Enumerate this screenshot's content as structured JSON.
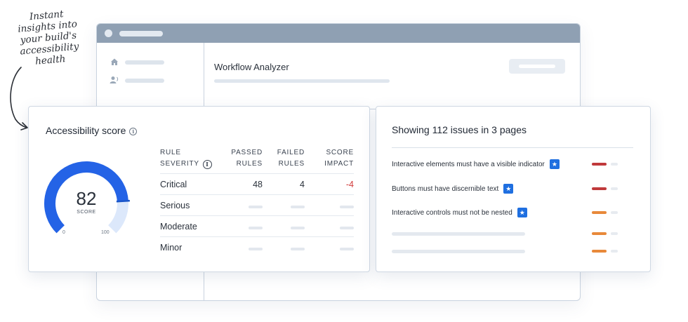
{
  "annotation": {
    "lines": [
      "Instant",
      "insights into",
      "your build's",
      "accessibility",
      "health"
    ]
  },
  "window": {
    "title": "Workflow Analyzer",
    "sidebar_icons": [
      "home-icon",
      "users-icon"
    ]
  },
  "score_card": {
    "title": "Accessibility score",
    "gauge": {
      "score": "82",
      "score_label": "SCORE",
      "min_label": "0",
      "max_label": "100",
      "value_fraction": 0.82,
      "fill_color": "#2463e6",
      "track_color": "#dce8fb"
    },
    "table": {
      "headers": {
        "severity_line1": "RULE",
        "severity_line2": "SEVERITY",
        "passed_line1": "PASSED",
        "passed_line2": "RULES",
        "failed_line1": "FAILED",
        "failed_line2": "RULES",
        "impact_line1": "SCORE",
        "impact_line2": "IMPACT"
      },
      "rows": [
        {
          "severity": "Critical",
          "passed": "48",
          "failed": "4",
          "impact": "-4"
        },
        {
          "severity": "Serious",
          "passed": "",
          "failed": "",
          "impact": ""
        },
        {
          "severity": "Moderate",
          "passed": "",
          "failed": "",
          "impact": ""
        },
        {
          "severity": "Minor",
          "passed": "",
          "failed": "",
          "impact": ""
        }
      ]
    }
  },
  "issues_card": {
    "title": "Showing 112 issues in 3 pages",
    "issues": [
      {
        "text": "Interactive elements must have a visible indicator",
        "starred": true,
        "severity_color": "#c0393b"
      },
      {
        "text": "Buttons must have discernible text",
        "starred": true,
        "severity_color": "#c0393b"
      },
      {
        "text": "Interactive controls must not be nested",
        "starred": true,
        "severity_color": "#e8893a"
      },
      {
        "text": "",
        "starred": false,
        "severity_color": "#e8893a"
      },
      {
        "text": "",
        "starred": false,
        "severity_color": "#e8893a"
      }
    ]
  }
}
